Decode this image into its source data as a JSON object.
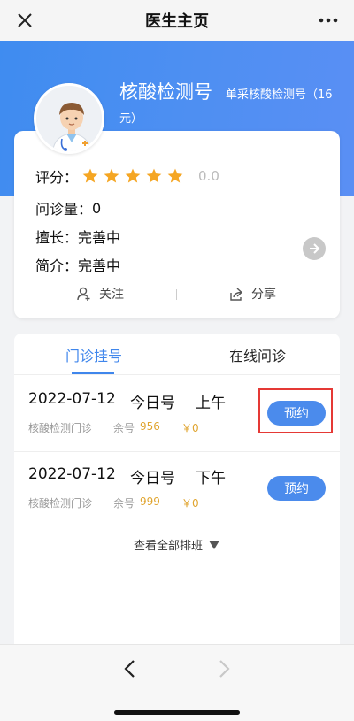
{
  "header": {
    "title": "医生主页",
    "close_icon": "close-icon",
    "more_icon": "more-dots-icon"
  },
  "doctor": {
    "name": "核酸检测号",
    "subtitle_line1": "单采核酸检测号（16",
    "subtitle_line2": "元）",
    "rating_label": "评分：",
    "rating_stars": 5,
    "rating_score": "0.0",
    "consult_label": "问诊量：",
    "consult_count": "0",
    "specialty_label": "擅长：",
    "specialty": "完善中",
    "intro_label": "简介：",
    "intro": "完善中"
  },
  "actions": {
    "follow": "关注",
    "share": "分享"
  },
  "tabs": [
    {
      "label": "门诊挂号",
      "active": true
    },
    {
      "label": "在线问诊",
      "active": false
    }
  ],
  "slots": [
    {
      "date": "2022-07-12",
      "type": "今日号",
      "period": "上午",
      "dept": "核酸检测门诊",
      "remain_label": "余号",
      "remain": "956",
      "price": "￥0",
      "button": "预约"
    },
    {
      "date": "2022-07-12",
      "type": "今日号",
      "period": "下午",
      "dept": "核酸检测门诊",
      "remain_label": "余号",
      "remain": "999",
      "price": "￥0",
      "button": "预约"
    }
  ],
  "view_all": "查看全部排班",
  "colors": {
    "accent": "#3f86ec",
    "star": "#f5a623",
    "price": "#e0a530",
    "highlight": "#e53935"
  }
}
